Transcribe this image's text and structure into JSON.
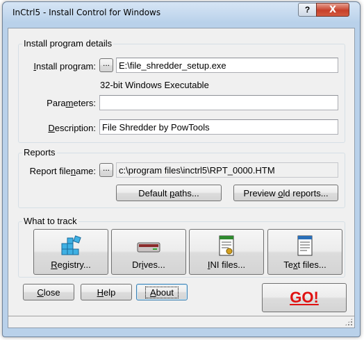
{
  "window": {
    "title": "InCtrl5 - Install Control for Windows",
    "help_btn": "?",
    "close_btn": "X"
  },
  "install": {
    "group_title": "Install program details",
    "program_label": "Install program:",
    "browse": "...",
    "program_value": "E:\\file_shredder_setup.exe",
    "program_type": "32-bit Windows Executable",
    "params_label": "Parameters:",
    "params_value": "",
    "desc_label": "Description:",
    "desc_value": "File Shredder by PowTools"
  },
  "reports": {
    "group_title": "Reports",
    "filename_label": "Report filename:",
    "browse": "...",
    "filename_value": "c:\\program files\\inctrl5\\RPT_0000.HTM",
    "default_paths": "Default paths...",
    "preview_old": "Preview old reports..."
  },
  "track": {
    "group_title": "What to track",
    "buttons": [
      {
        "label": "Registry...",
        "icon": "registry-icon"
      },
      {
        "label": "Drives...",
        "icon": "drive-icon"
      },
      {
        "label": "INI files...",
        "icon": "ini-file-icon"
      },
      {
        "label": "Text files...",
        "icon": "text-file-icon"
      }
    ]
  },
  "footer": {
    "close": "Close",
    "help": "Help",
    "about": "About",
    "go": "GO!"
  }
}
